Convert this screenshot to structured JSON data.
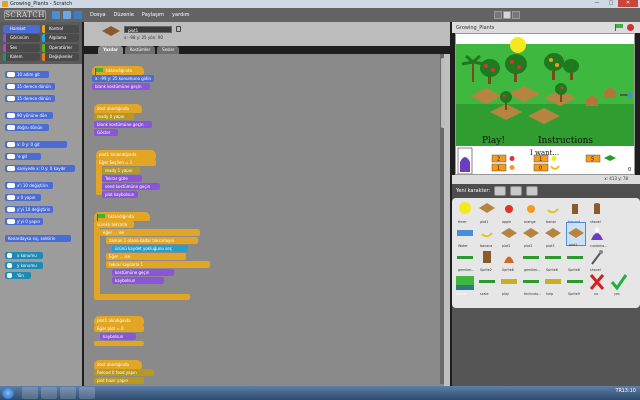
{
  "window": {
    "title": "Growing_Plants - Scratch",
    "controls": [
      "—",
      "□",
      "✕"
    ]
  },
  "menubar": {
    "logo": "SCRATCH",
    "menus": [
      "Dosya",
      "Düzenle",
      "Paylaşım",
      "yardım"
    ]
  },
  "categories": [
    {
      "label": "Hareket",
      "color": "#4a6cd4"
    },
    {
      "label": "Kontrol",
      "color": "#e1a91a"
    },
    {
      "label": "Görünüm",
      "color": "#8a55d7"
    },
    {
      "label": "Algılama",
      "color": "#2ca5e2"
    },
    {
      "label": "Ses",
      "color": "#bb42c3"
    },
    {
      "label": "Operatörler",
      "color": "#5cb712"
    },
    {
      "label": "Kalem",
      "color": "#0e9a6c"
    },
    {
      "label": "Değişkenler",
      "color": "#ee7d16"
    }
  ],
  "palette": [
    "10 adım git",
    "15 derece dönün",
    "15 derece dönün",
    "90 yönüne dön",
    "doğru dönün",
    "x: 0 y: 0 git",
    "'e git",
    "saniyede x: 0 y: 0 kaydır",
    "x'i 10 değiştirin",
    "x 0 yapın",
    "y'yi 10 değiştirin",
    "y'yi 0 yapın",
    "Kenardaysa sıç, sektirin",
    "x konumu",
    "y konumu",
    "Yön"
  ],
  "sprite": {
    "name": "plot1",
    "coords": "x: -98  y: 25  yön: 90"
  },
  "tabs": [
    {
      "label": "Yazılar",
      "active": true
    },
    {
      "label": "Kostümler",
      "active": false
    },
    {
      "label": "Sesler",
      "active": false
    }
  ],
  "scripts": {
    "s1": [
      "tıklandığında",
      "x: -99 y: 25 konumuna gidin",
      "blank kostümüne geçin"
    ],
    "s2": [
      "dost alındığında",
      "ready 0 yapın",
      "blank kostümüne geçin",
      "Göster"
    ],
    "s3": [
      "plot1 tıklandığında",
      "Eğer Seçilen = 1",
      "ready 1 yapın",
      "Tekrar gizle",
      "seed kostümüne geçin",
      "plot kaybolsun"
    ],
    "s4": [
      "tıklandığında",
      "sürekli tekrarla",
      "eğer ... ise",
      "zaman 1 olana kadar tekrarlayın",
      "ürünü kaydet yokluğunu seç",
      "Eğer ... ise",
      "tekrar sayılarla 1",
      "kostümüne geçin",
      "kaybolsun"
    ],
    "s5": [
      "plot1 alındığında",
      "Eğer plot = 0",
      "kaybolsun"
    ],
    "s6": [
      "dost alındığında",
      "Reload 0 food yapın",
      "plot hazır yapın"
    ]
  },
  "stage": {
    "title": "Growing_Plants",
    "play_label": "Play!",
    "instructions_label": "Instructions",
    "want_label": "I want...",
    "counters": [
      "2",
      "1",
      "1",
      "0",
      "5",
      "0"
    ],
    "mouse_coords": "x: 413  y: 78"
  },
  "new_sprite_label": "Yeni karakter:",
  "sprites": [
    {
      "name": "timer",
      "color": "#f5e81f"
    },
    {
      "name": "plot1",
      "color": "#b58440"
    },
    {
      "name": "apple",
      "color": "#e03030"
    },
    {
      "name": "orange",
      "color": "#f59a1f"
    },
    {
      "name": "banan",
      "color": "#f5e81f"
    },
    {
      "name": "basvuıt",
      "color": "#8a5a2a"
    },
    {
      "name": "shovel",
      "color": "#8a5a2a"
    },
    {
      "name": "Water",
      "color": "#4a8fd6"
    },
    {
      "name": "banana",
      "color": "#f5e81f"
    },
    {
      "name": "plot2",
      "color": "#b58440"
    },
    {
      "name": "plot2",
      "color": "#b58440"
    },
    {
      "name": "plot3",
      "color": "#b58440"
    },
    {
      "name": "plot1",
      "color": "#b58440"
    },
    {
      "name": "customa...",
      "color": "#6a3ec0"
    },
    {
      "name": "gemiker...",
      "color": "#2a9a2a"
    },
    {
      "name": "Sprite2",
      "color": "#8a5a2a"
    },
    {
      "name": "Sprite6",
      "color": "#cc6a2a"
    },
    {
      "name": "gemiker...",
      "color": "#2a9a2a"
    },
    {
      "name": "Sprite6",
      "color": "#2a9a2a"
    },
    {
      "name": "Sprite6",
      "color": "#2a9a2a"
    },
    {
      "name": "shovel",
      "color": "#555555"
    },
    {
      "name": "scale",
      "color": "#2a9a2a"
    },
    {
      "name": "play",
      "color": "#c8b020"
    },
    {
      "name": "technolo...",
      "color": "#2a9a2a"
    },
    {
      "name": "help",
      "color": "#c8b020"
    },
    {
      "name": "Sprite9",
      "color": "#2a9a2a"
    },
    {
      "name": "no",
      "color": "#d02020"
    },
    {
      "name": "yes",
      "color": "#20b040"
    }
  ],
  "stage_thumb_label": "Sahne",
  "taskbar": {
    "lang": "TR",
    "clock": "13:10"
  }
}
